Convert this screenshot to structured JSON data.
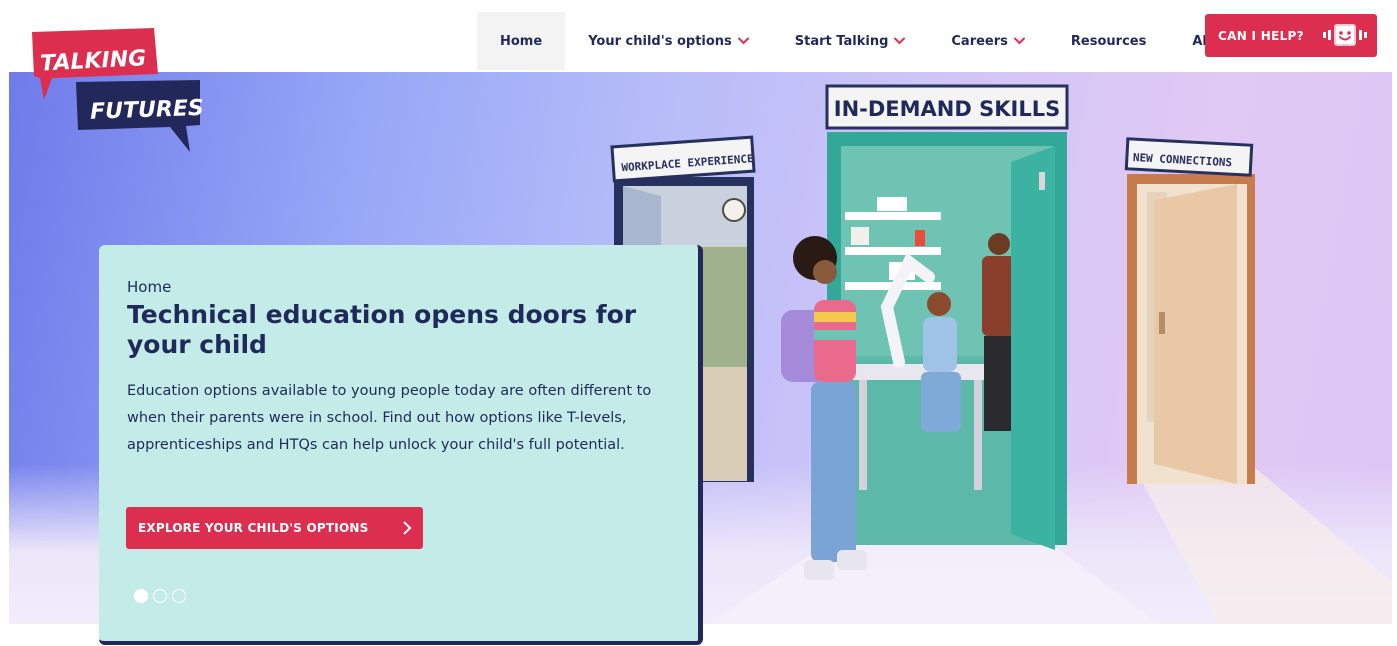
{
  "logo": {
    "line1": "TALKING",
    "line2": "FUTURES"
  },
  "nav": {
    "items": [
      {
        "label": "Home"
      },
      {
        "label": "Your child's options"
      },
      {
        "label": "Start Talking"
      },
      {
        "label": "Careers"
      },
      {
        "label": "Resources"
      },
      {
        "label": "About"
      }
    ],
    "help_label": "CAN I HELP?"
  },
  "hero": {
    "signs": {
      "center": "IN-DEMAND SKILLS",
      "left": "WORKPLACE EXPERIENCE",
      "right": "NEW CONNECTIONS"
    },
    "card": {
      "breadcrumb": "Home",
      "title": "Technical education opens doors for your child",
      "text": "Education options available to young people today are often different to when their parents were in school. Find out how options like T-levels, apprenticeships and HTQs can help unlock your child's full potential.",
      "cta_label": "EXPLORE YOUR CHILD'S OPTIONS"
    },
    "carousel": {
      "slides": 3,
      "active_index": 0
    }
  },
  "colors": {
    "brand_red": "#dc2e4f",
    "navy": "#1f2a5a",
    "card_mint": "#c3ece8",
    "door_teal": "#3cb3a2"
  },
  "icons": [
    "chevron-down-icon",
    "chevron-right-icon",
    "chat-face-icon"
  ]
}
